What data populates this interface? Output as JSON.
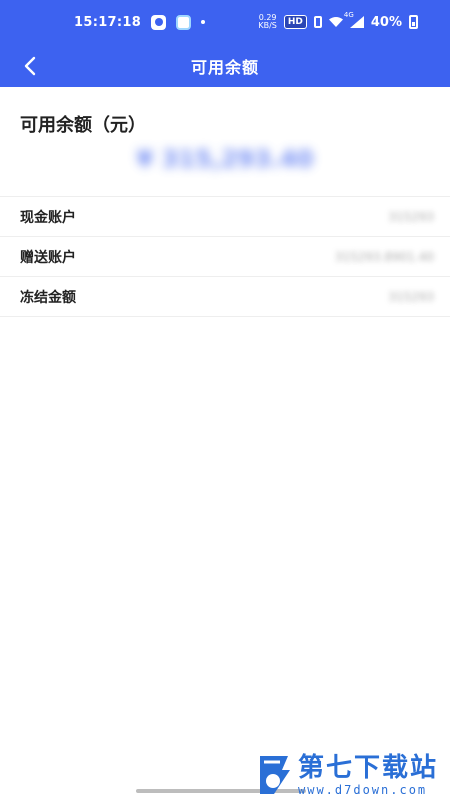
{
  "status_bar": {
    "time": "15:17:18",
    "net_speed_value": "0.29",
    "net_speed_unit": "KB/S",
    "hd_badge": "HD",
    "network_type": "4G",
    "battery": "40%"
  },
  "nav": {
    "title": "可用余额"
  },
  "balance": {
    "label": "可用余额（元）",
    "amount": "¥ 315,293.40"
  },
  "accounts": [
    {
      "label": "现金账户",
      "value": "315293"
    },
    {
      "label": "赠送账户",
      "value": "315293.8901.40"
    },
    {
      "label": "冻结金额",
      "value": "315293"
    }
  ],
  "watermark": {
    "title": "第七下载站",
    "url": "www.d7down.com"
  },
  "colors": {
    "brand": "#3d62f0",
    "amount": "#4a6cf0",
    "watermark": "#2a6fd6"
  }
}
